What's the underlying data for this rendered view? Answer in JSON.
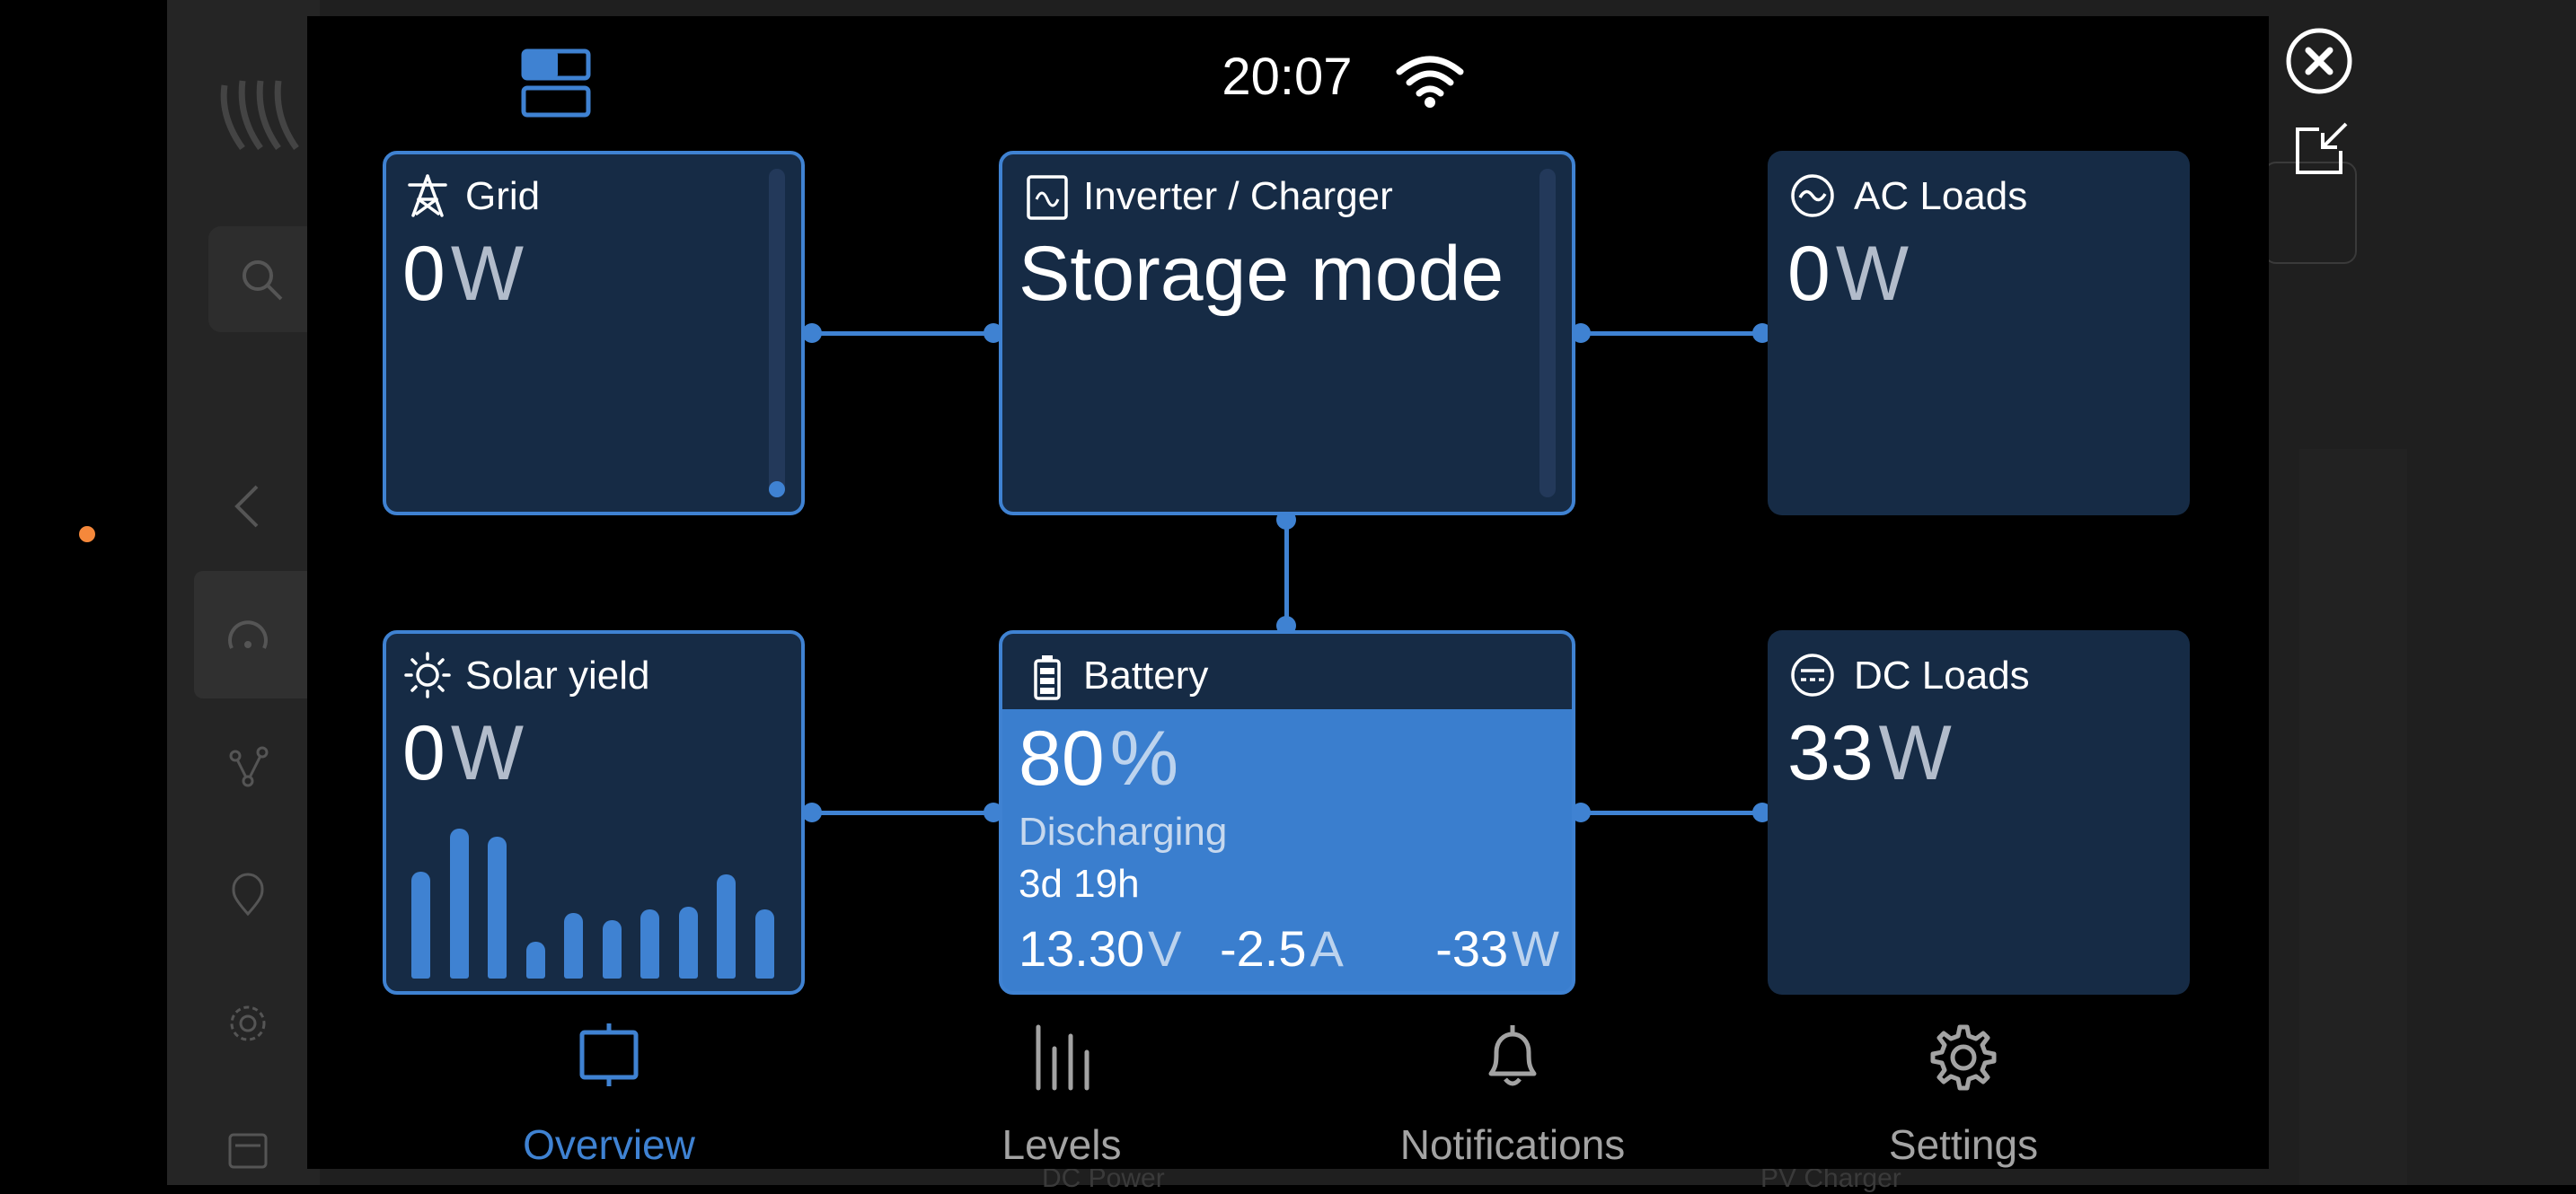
{
  "status_bar": {
    "time": "20:07",
    "wifi_icon": "wifi-icon",
    "layout_icon": "layout-toggle-icon"
  },
  "window_controls": {
    "close_icon": "close-icon",
    "exit_fullscreen_icon": "shrink-window-icon"
  },
  "cards": {
    "grid": {
      "title": "Grid",
      "value": "0",
      "unit": "W",
      "icon": "transmission-tower-icon"
    },
    "inverter": {
      "title": "Inverter / Charger",
      "state": "Storage mode",
      "icon": "inverter-icon"
    },
    "ac_loads": {
      "title": "AC Loads",
      "value": "0",
      "unit": "W",
      "icon": "ac-wave-icon"
    },
    "solar": {
      "title": "Solar yield",
      "value": "0",
      "unit": "W",
      "icon": "sun-icon",
      "bar_history": [
        0.7,
        0.98,
        0.93,
        0.24,
        0.43,
        0.38,
        0.45,
        0.47,
        0.68,
        0.45
      ]
    },
    "battery": {
      "title": "Battery",
      "icon": "battery-icon",
      "soc_value": "80",
      "soc_unit": "%",
      "state": "Discharging",
      "time_to_go": "3d 19h",
      "voltage_value": "13.30",
      "voltage_unit": "V",
      "current_value": "-2.5",
      "current_unit": "A",
      "power_value": "-33",
      "power_unit": "W"
    },
    "dc_loads": {
      "title": "DC Loads",
      "value": "33",
      "unit": "W",
      "icon": "dc-icon"
    }
  },
  "nav": {
    "items": [
      {
        "label": "Overview",
        "icon": "overview-icon",
        "active": true
      },
      {
        "label": "Levels",
        "icon": "levels-icon",
        "active": false
      },
      {
        "label": "Notifications",
        "icon": "bell-icon",
        "active": false
      },
      {
        "label": "Settings",
        "icon": "gear-icon",
        "active": false
      }
    ]
  },
  "background": {
    "bottom_labels": [
      "DC Power",
      "PV Charger"
    ]
  },
  "colors": {
    "accent": "#3f82d2",
    "card_bg": "#162b45",
    "battery_fill": "#3a7ece",
    "orange_dot": "#f5883b"
  }
}
